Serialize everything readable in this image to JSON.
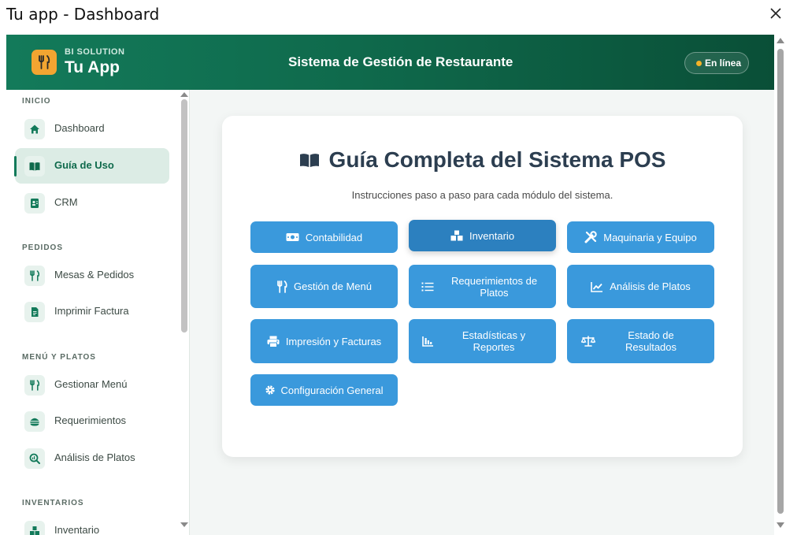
{
  "window": {
    "title": "Tu app - Dashboard"
  },
  "header": {
    "brand_small": "BI SOLUTION",
    "brand_name": "Tu App",
    "title": "Sistema de Gestión de Restaurante",
    "status": "En línea",
    "colors": {
      "gradient_start": "#137a5a",
      "gradient_end": "#0a4f37",
      "logo_bg": "#f2a531",
      "status_dot": "#f5b227"
    }
  },
  "sidebar": {
    "sections": [
      {
        "title": "INICIO",
        "items": [
          {
            "label": "Dashboard",
            "icon": "home-icon"
          },
          {
            "label": "Guía de Uso",
            "icon": "book-icon",
            "active": true
          },
          {
            "label": "CRM",
            "icon": "contact-card-icon"
          }
        ]
      },
      {
        "title": "PEDIDOS",
        "items": [
          {
            "label": "Mesas & Pedidos",
            "icon": "utensils-icon"
          },
          {
            "label": "Imprimir Factura",
            "icon": "invoice-icon"
          }
        ]
      },
      {
        "title": "MENÚ Y PLATOS",
        "items": [
          {
            "label": "Gestionar Menú",
            "icon": "utensils-icon"
          },
          {
            "label": "Requerimientos",
            "icon": "burger-icon"
          },
          {
            "label": "Análisis de Platos",
            "icon": "search-chart-icon"
          }
        ]
      },
      {
        "title": "INVENTARIOS",
        "items": [
          {
            "label": "Inventario",
            "icon": "boxes-icon"
          }
        ]
      }
    ]
  },
  "guide": {
    "title": "Guía Completa del Sistema POS",
    "subtitle": "Instrucciones paso a paso para cada módulo del sistema.",
    "buttons": [
      {
        "label": "Contabilidad",
        "icon": "money-icon"
      },
      {
        "label": "Inventario",
        "icon": "boxes-icon",
        "active": true
      },
      {
        "label": "Maquinaria y Equipo",
        "icon": "tools-icon"
      },
      {
        "label": "Gestión de Menú",
        "icon": "utensils-icon"
      },
      {
        "label": "Requerimientos de Platos",
        "icon": "list-icon"
      },
      {
        "label": "Análisis de Platos",
        "icon": "line-chart-icon"
      },
      {
        "label": "Impresión y Facturas",
        "icon": "printer-icon"
      },
      {
        "label": "Estadísticas y Reportes",
        "icon": "bar-chart-icon"
      },
      {
        "label": "Estado de Resultados",
        "icon": "scale-icon"
      },
      {
        "label": "Configuración General",
        "icon": "gear-icon"
      }
    ],
    "colors": {
      "button": "#3a99dc",
      "button_active": "#2c80bf",
      "title": "#2c3e50"
    }
  }
}
